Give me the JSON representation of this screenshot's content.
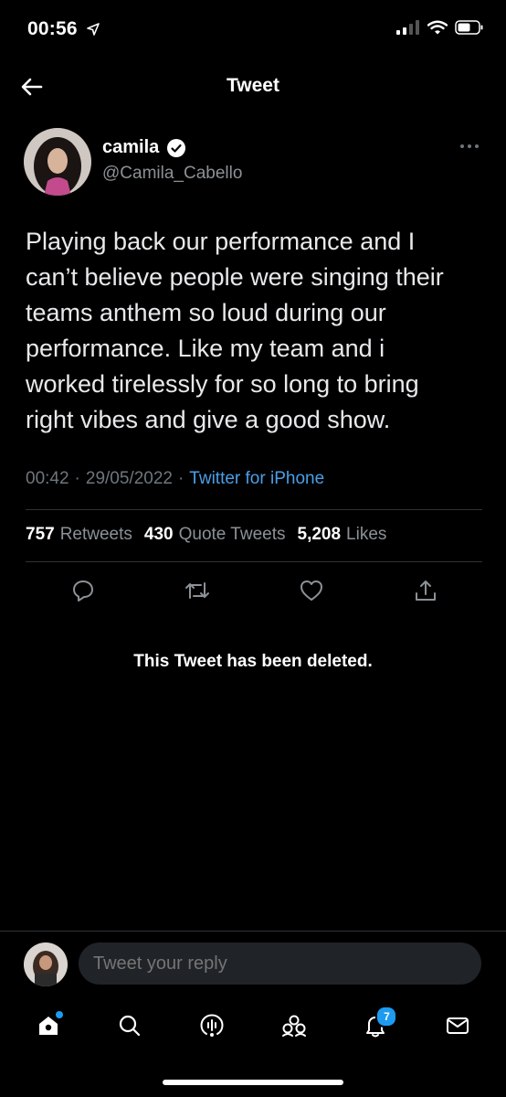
{
  "status_bar": {
    "time": "00:56",
    "icons": [
      "location-arrow-icon",
      "signal-icon",
      "wifi-icon",
      "battery-icon"
    ]
  },
  "header": {
    "title": "Tweet",
    "back_icon": "back-arrow-icon"
  },
  "tweet": {
    "author": {
      "name": "camila",
      "handle": "@Camila_Cabello",
      "verified": true
    },
    "text": "Playing back our performance and I\ncan’t believe people were singing their\nteams anthem so loud during our\nperformance. Like my team and i\nworked tirelessly for so long to bring\nright vibes and give a good show.",
    "time": "00:42",
    "separator": "·",
    "date": "29/05/2022",
    "source": "Twitter for iPhone",
    "stats": {
      "retweets_count": "757",
      "retweets_label": "Retweets",
      "quotes_count": "430",
      "quotes_label": "Quote Tweets",
      "likes_count": "5,208",
      "likes_label": "Likes"
    },
    "actions": [
      "reply-icon",
      "retweet-icon",
      "like-icon",
      "share-icon"
    ]
  },
  "deleted_notice": "This Tweet has been deleted.",
  "reply_bar": {
    "placeholder": "Tweet your reply"
  },
  "tab_bar": {
    "items": [
      "home-icon",
      "search-icon",
      "spaces-icon",
      "communities-icon",
      "notifications-icon",
      "messages-icon"
    ],
    "notifications_badge": "7"
  },
  "colors": {
    "background": "#000000",
    "link": "#4a9fe8",
    "muted": "#8b9196",
    "accent": "#1d9bf0"
  }
}
